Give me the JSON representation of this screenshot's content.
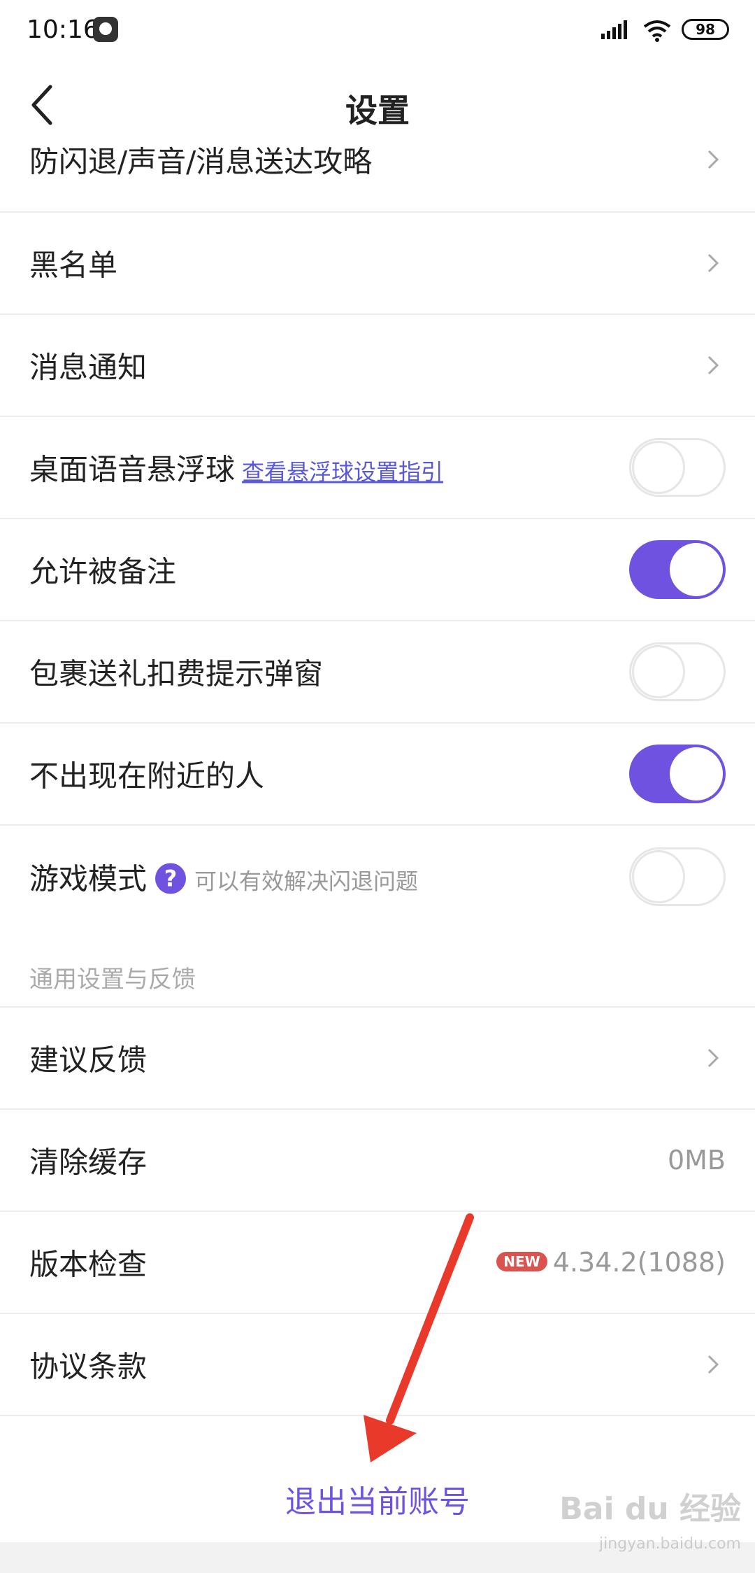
{
  "status_bar": {
    "time": "10:16",
    "battery": "98"
  },
  "header": {
    "title": "设置"
  },
  "rows": {
    "crash_guide": "防闪退/声音/消息送达攻略",
    "blacklist": "黑名单",
    "notifications": "消息通知",
    "voice_ball": "桌面语音悬浮球",
    "voice_ball_link": "查看悬浮球设置指引",
    "allow_remark": "允许被备注",
    "gift_popup": "包裹送礼扣费提示弹窗",
    "hide_nearby": "不出现在附近的人",
    "game_mode": "游戏模式",
    "game_mode_help": "?",
    "game_mode_hint": "可以有效解决闪退问题",
    "feedback": "建议反馈",
    "clear_cache": "清除缓存",
    "clear_cache_value": "0MB",
    "version_check": "版本检查",
    "version_badge": "NEW",
    "version_value": "4.34.2(1088)",
    "terms": "协议条款"
  },
  "toggles": {
    "voice_ball": false,
    "allow_remark": true,
    "gift_popup": false,
    "hide_nearby": true,
    "game_mode": false
  },
  "section": {
    "general": "通用设置与反馈"
  },
  "logout": {
    "label": "退出当前账号"
  },
  "watermark": {
    "main": "Bai du 经验",
    "sub": "jingyan.baidu.com"
  },
  "colors": {
    "accent": "#6f52e0",
    "arrow": "#e8392b",
    "badge": "#d9534f"
  }
}
